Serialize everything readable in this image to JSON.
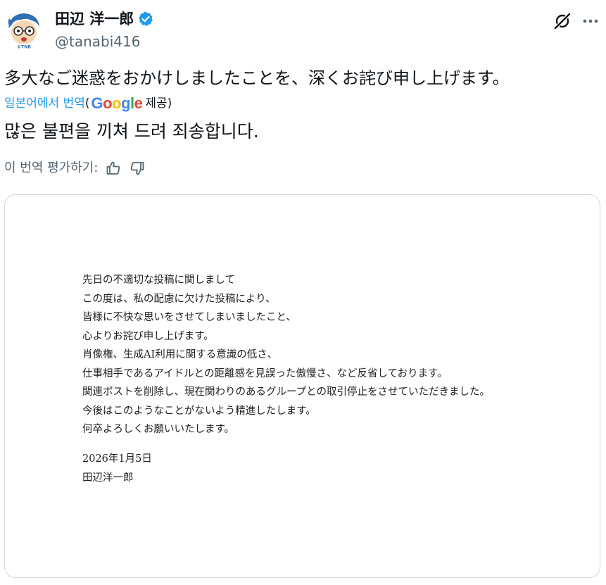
{
  "author": {
    "display_name": "田辺 洋一郎",
    "handle": "@tanabi416",
    "avatar_caption": "©TNB",
    "verified_color": "#1d9bf0"
  },
  "post": {
    "original_text": "多大なご迷惑をおかけしましたことを、深くお詫び申し上げます。",
    "translation_prefix": "일본어에서 번역",
    "translation_open": "(",
    "translation_provider": "Google",
    "translation_suffix": "제공)",
    "translated_text": "많은 불편을 끼쳐 드려 죄송합니다.",
    "rate_label": "이 번역 평가하기:"
  },
  "icons": {
    "grok": "grok-icon",
    "more": "more-icon",
    "thumbs_up": "thumbs-up-icon",
    "thumbs_down": "thumbs-down-icon",
    "verified": "verified-badge-icon"
  },
  "letter": {
    "lines": [
      "先日の不適切な投稿に関しまして",
      "この度は、私の配慮に欠けた投稿により、",
      "皆様に不快な思いをさせてしまいましたこと、",
      "心よりお詫び申し上げます。",
      "肖像権、生成AI利用に関する意識の低さ、",
      "仕事相手であるアイドルとの距離感を見誤った傲慢さ、など反省しております。",
      "関連ポストを削除し、現在関わりのあるグループとの取引停止をさせていただきました。",
      "今後はこのようなことがないよう精進したします。",
      "何卒よろしくお願いいたします。"
    ],
    "date": "2026年1月5日",
    "signature": "田辺洋一郎"
  },
  "colors": {
    "text_primary": "#0f1419",
    "text_secondary": "#536471",
    "link": "#1d9bf0",
    "border": "#cfd9de"
  }
}
